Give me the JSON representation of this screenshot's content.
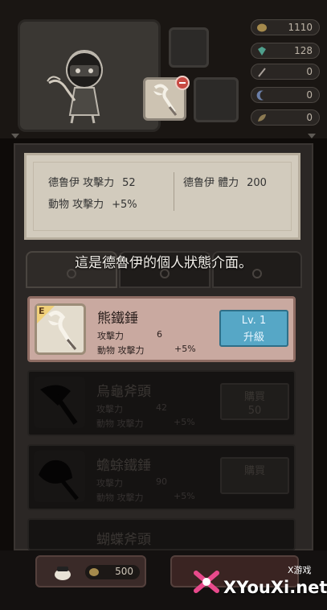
{
  "resources": [
    {
      "icon": "gold-coin-icon",
      "value": "1110"
    },
    {
      "icon": "gem-icon",
      "value": "128"
    },
    {
      "icon": "feather-icon",
      "value": "0"
    },
    {
      "icon": "moon-icon",
      "value": "0"
    },
    {
      "icon": "leaf-icon",
      "value": "0"
    }
  ],
  "stats": {
    "attack_label": "德鲁伊 攻擊力",
    "attack_value": "52",
    "hp_label": "德鲁伊 體力",
    "hp_value": "200",
    "animal_label": "動物 攻擊力",
    "animal_value": "+5%"
  },
  "hint": "這是德魯伊的個人狀態介面。",
  "weapons": [
    {
      "rank": "E",
      "name": "熊鐵錘",
      "attack_label": "攻擊力",
      "attack_value": "6",
      "animal_label": "動物 攻擊力",
      "animal_value": "+5%",
      "button_line1": "Lv. 1",
      "button_line2": "升級"
    },
    {
      "name": "烏龜斧頭",
      "attack_label": "攻擊力",
      "attack_value": "42",
      "animal_label": "動物 攻擊力",
      "animal_value": "+5%",
      "button_line1": "購買",
      "button_line2": "50"
    },
    {
      "name": "蟾蜍鐵錘",
      "attack_label": "攻擊力",
      "attack_value": "90",
      "animal_label": "動物 攻擊力",
      "animal_value": "+5%",
      "button_line1": "購買",
      "button_line2": ""
    },
    {
      "name": "蝴蝶斧頭"
    }
  ],
  "bottom": {
    "coin_value": "500"
  },
  "watermark": {
    "brand": "XYouXi.net",
    "tag": "X游戏"
  },
  "colors": {
    "selected_bg": "#c9a9a0",
    "upgrade_button": "#56a7c6",
    "rank_badge": "#f0d07a"
  }
}
